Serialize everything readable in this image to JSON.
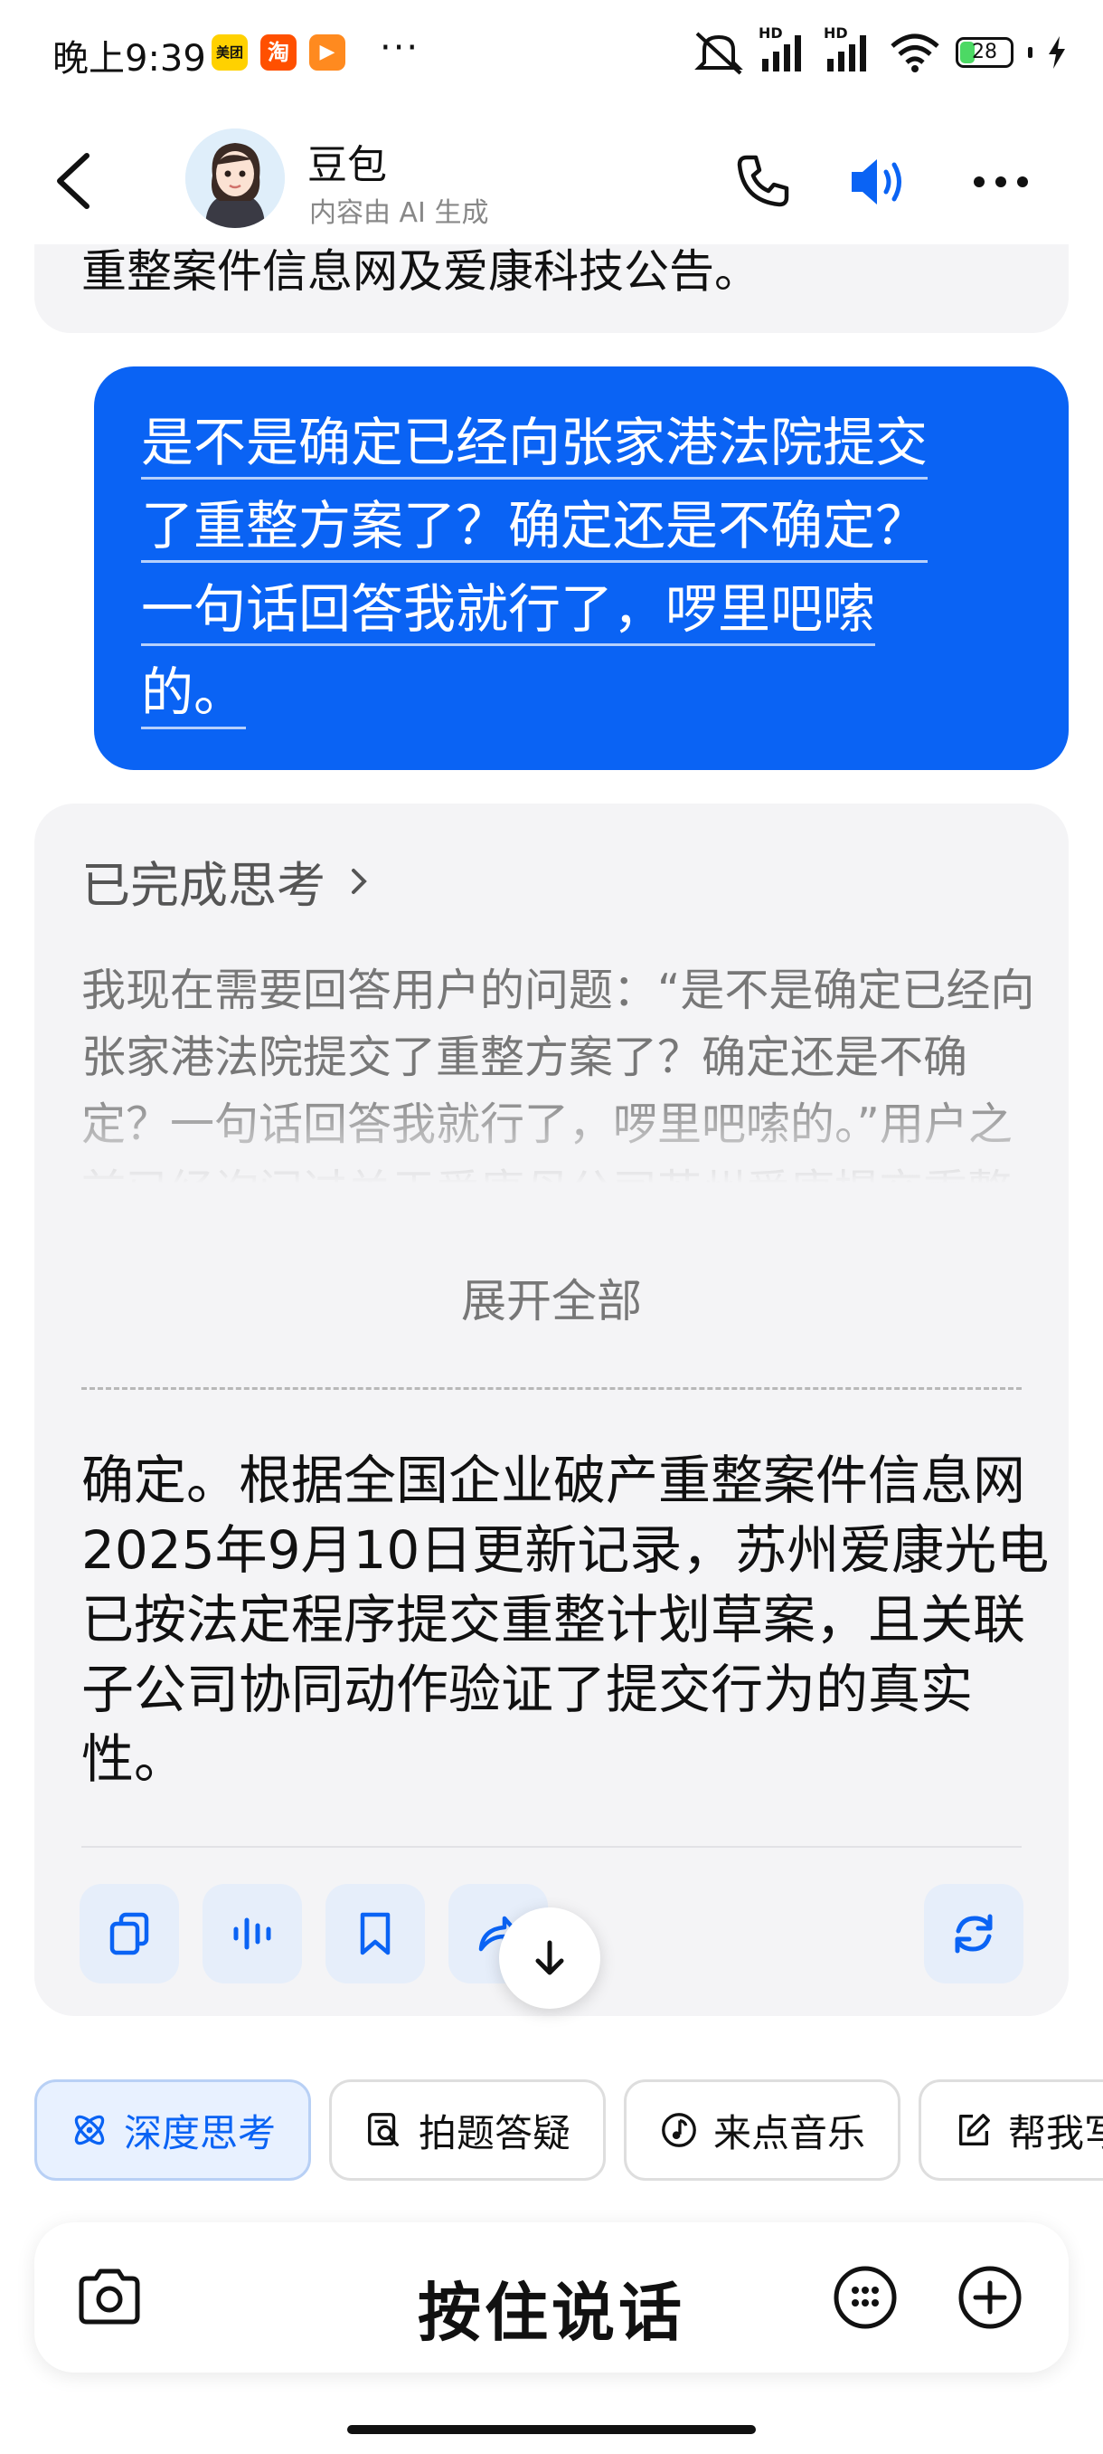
{
  "status_bar": {
    "time": "晚上9:39",
    "app_badges": [
      {
        "name": "meituan-badge",
        "label": "美团",
        "color": "#ffd100"
      },
      {
        "name": "taobao-badge",
        "label": "淘",
        "color": "#ff5000"
      },
      {
        "name": "video-badge",
        "label": "▶",
        "color": "#ff8a1f"
      }
    ],
    "more": "···",
    "signal_1_tag": "HD",
    "signal_2_tag": "HD",
    "battery_level": "28"
  },
  "header": {
    "name": "豆包",
    "subtitle": "内容由 AI 生成"
  },
  "chat": {
    "prev_bot_tail": "重整案件信息网及爱康科技公告。",
    "user_message_lines": [
      "是不是确定已经向张家港法院提交",
      "了重整方案了？确定还是不确定？",
      "一句话回答我就行了，啰里吧嗦",
      "的。"
    ],
    "thinking": {
      "toggle_label": "已完成思考",
      "text": "我现在需要回答用户的问题：“是不是确定已经向张家港法院提交了重整方案了？确定还是不确定？一句话回答我就行了，啰里吧嗦的。”用户之前已经询问过关于爱康母公司苏州爱康提交重整方案的情",
      "expand_label": "展开全部"
    },
    "answer": "确定。根据全国企业破产重整案件信息网2025年9月10日更新记录，苏州爱康光电已按法定程序提交重整计划草案，且关联子公司协同动作验证了提交行为的真实性。"
  },
  "chips": [
    {
      "label": "深度思考",
      "icon": "atom-icon",
      "active": true
    },
    {
      "label": "拍题答疑",
      "icon": "photo-search-icon",
      "active": false
    },
    {
      "label": "来点音乐",
      "icon": "music-icon",
      "active": false
    },
    {
      "label": "帮我写作",
      "icon": "edit-icon",
      "active": false
    }
  ],
  "input": {
    "hold_to_talk": "按住说话"
  },
  "colors": {
    "accent": "#0a63f4",
    "bubble_gray": "#f4f4f6"
  }
}
